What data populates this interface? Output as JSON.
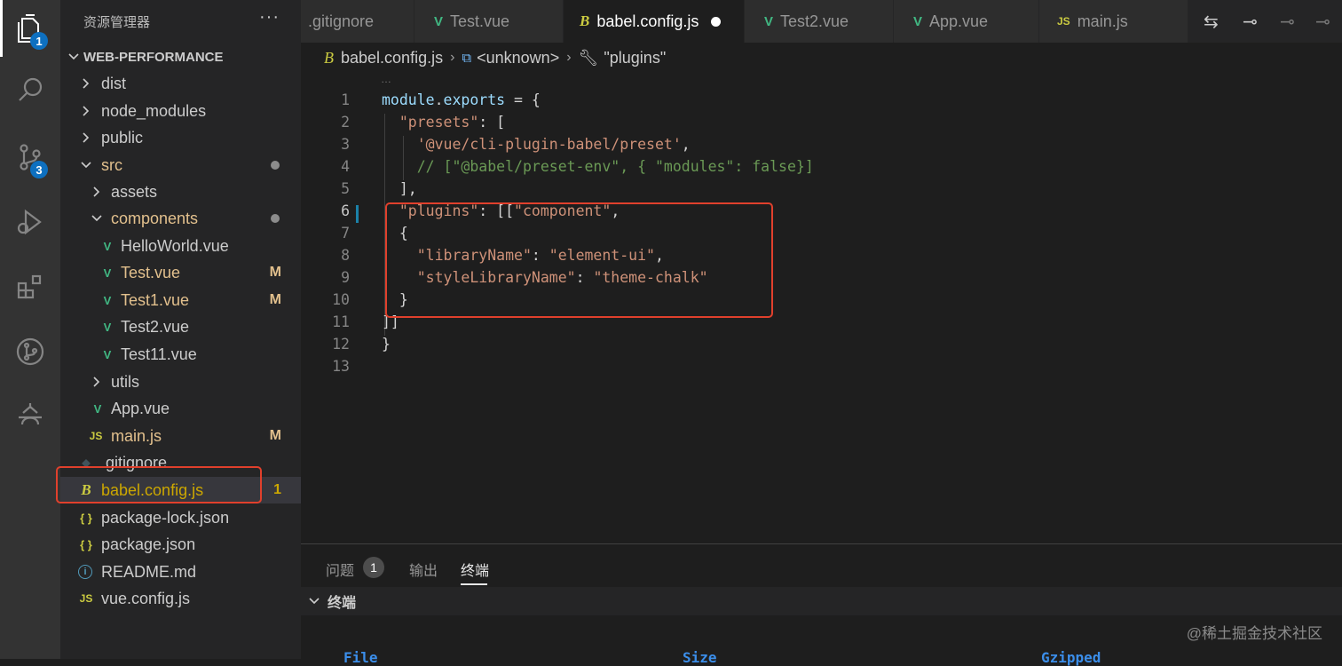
{
  "activity_bar": {
    "explorer_badge": "1",
    "scm_badge": "3",
    "icons": [
      "files-icon",
      "search-icon",
      "source-control-icon",
      "run-debug-icon",
      "extensions-icon",
      "git-graph-icon",
      "timeline-icon"
    ]
  },
  "explorer": {
    "title": "资源管理器",
    "more": "···",
    "project": "WEB-PERFORMANCE",
    "items": [
      {
        "label": "dist",
        "status": ""
      },
      {
        "label": "node_modules",
        "status": ""
      },
      {
        "label": "public",
        "status": ""
      },
      {
        "label": "src",
        "status": ""
      },
      {
        "label": "assets",
        "status": ""
      },
      {
        "label": "components",
        "status": ""
      },
      {
        "label": "HelloWorld.vue",
        "status": ""
      },
      {
        "label": "Test.vue",
        "status": "M"
      },
      {
        "label": "Test1.vue",
        "status": "M"
      },
      {
        "label": "Test2.vue",
        "status": ""
      },
      {
        "label": "Test11.vue",
        "status": ""
      },
      {
        "label": "utils",
        "status": ""
      },
      {
        "label": "App.vue",
        "status": ""
      },
      {
        "label": "main.js",
        "status": "M"
      },
      {
        "label": ".gitignore",
        "status": ""
      },
      {
        "label": "babel.config.js",
        "status": "1"
      },
      {
        "label": "package-lock.json",
        "status": ""
      },
      {
        "label": "package.json",
        "status": ""
      },
      {
        "label": "README.md",
        "status": ""
      },
      {
        "label": "vue.config.js",
        "status": ""
      }
    ],
    "icon_glyphs": {
      "vue": "V",
      "js": "JS",
      "json": "{ }",
      "babel": "B",
      "info": "i",
      "git": "◆"
    }
  },
  "tabs": [
    {
      "label": ".gitignore"
    },
    {
      "label": "Test.vue",
      "icon": "V"
    },
    {
      "label": "babel.config.js",
      "icon": "B"
    },
    {
      "label": "Test2.vue",
      "icon": "V"
    },
    {
      "label": "App.vue",
      "icon": "V"
    },
    {
      "label": "main.js",
      "icon": "JS"
    }
  ],
  "breadcrumb": {
    "file": "babel.config.js",
    "symbol": "<unknown>",
    "property": "\"plugins\"",
    "ellipsis": "…"
  },
  "editor": {
    "current_line": "6",
    "lines": [
      {
        "n": "1",
        "parts": [
          [
            "k-var",
            "module"
          ],
          [
            "k-punc",
            "."
          ],
          [
            "k-var",
            "exports"
          ],
          [
            "k-punc",
            " = {"
          ]
        ]
      },
      {
        "n": "2",
        "parts": [
          [
            "k-punc",
            "  "
          ],
          [
            "k-str",
            "\"presets\""
          ],
          [
            "k-punc",
            ": ["
          ]
        ]
      },
      {
        "n": "3",
        "parts": [
          [
            "k-punc",
            "    "
          ],
          [
            "k-str",
            "'@vue/cli-plugin-babel/preset'"
          ],
          [
            "k-punc",
            ","
          ]
        ]
      },
      {
        "n": "4",
        "parts": [
          [
            "k-punc",
            "    "
          ],
          [
            "k-com",
            "// [\"@babel/preset-env\", { \"modules\": false}]"
          ]
        ]
      },
      {
        "n": "5",
        "parts": [
          [
            "k-punc",
            "  ],"
          ]
        ]
      },
      {
        "n": "6",
        "parts": [
          [
            "k-punc",
            "  "
          ],
          [
            "k-str",
            "\"plugins\""
          ],
          [
            "k-punc",
            ": [["
          ],
          [
            "k-str",
            "\"component\""
          ],
          [
            "k-punc",
            ","
          ]
        ]
      },
      {
        "n": "7",
        "parts": [
          [
            "k-punc",
            "  {"
          ]
        ]
      },
      {
        "n": "8",
        "parts": [
          [
            "k-punc",
            "    "
          ],
          [
            "k-str",
            "\"libraryName\""
          ],
          [
            "k-punc",
            ": "
          ],
          [
            "k-str",
            "\"element-ui\""
          ],
          [
            "k-punc",
            ","
          ]
        ]
      },
      {
        "n": "9",
        "parts": [
          [
            "k-punc",
            "    "
          ],
          [
            "k-str",
            "\"styleLibraryName\""
          ],
          [
            "k-punc",
            ": "
          ],
          [
            "k-str",
            "\"theme-chalk\""
          ]
        ]
      },
      {
        "n": "10",
        "parts": [
          [
            "k-punc",
            "  }"
          ]
        ]
      },
      {
        "n": "11",
        "parts": [
          [
            "k-punc",
            "]]"
          ]
        ]
      },
      {
        "n": "12",
        "parts": [
          [
            "k-punc",
            "}"
          ]
        ]
      },
      {
        "n": "13",
        "parts": []
      }
    ]
  },
  "panel": {
    "tabs": [
      "问题",
      "输出",
      "终端"
    ],
    "problems_count": "1",
    "terminal_header": "终端",
    "terminal_columns": [
      "File",
      "Size",
      "Gzipped"
    ],
    "watermark": "@稀土掘金技术社区"
  },
  "colors": {
    "accent": "#0e70c0",
    "highlight_box": "#e0402c",
    "vue_green": "#41b883",
    "js_yellow": "#cbcb41",
    "modified": "#e2c08d"
  }
}
